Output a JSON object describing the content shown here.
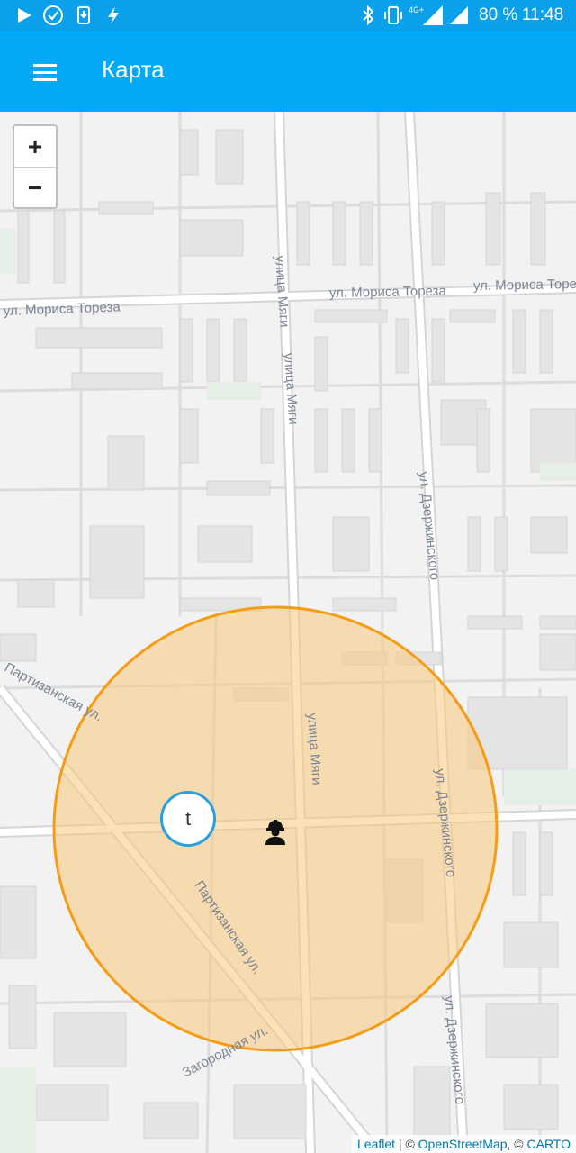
{
  "status_bar": {
    "battery": "80 %",
    "time": "11:48",
    "network": "4G+"
  },
  "app_bar": {
    "title": "Карта",
    "menu_icon": "hamburger-menu-icon"
  },
  "map": {
    "zoom_in_label": "+",
    "zoom_out_label": "−",
    "marker_label": "t",
    "worker_icon": "construction-worker-icon",
    "circle_color": "#f7a21b",
    "circle_fill": "#fbc87a",
    "streets": {
      "moris_toreza_1": "ул. Мориса Тореза",
      "moris_toreza_2": "ул. Мориса Тореза",
      "moris_toreza_3": "ул. Мориса Тореза",
      "myagi_1": "улица Мяги",
      "myagi_2": "улица Мяги",
      "myagi_3": "улица Мяги",
      "dzerzhinskogo_1": "ул. Дзержинского",
      "dzerzhinskogo_2": "ул. Дзержинского",
      "dzerzhinskogo_3": "ул. Дзержинского",
      "partizanskaya_1": "Партизанская ул.",
      "partizanskaya_2": "Партизанская ул.",
      "zagorodnaya": "Загородная ул."
    }
  },
  "attribution": {
    "leaflet": "Leaflet",
    "sep1": " | © ",
    "osm": "OpenStreetMap",
    "sep2": ", © ",
    "carto": "CARTO"
  }
}
